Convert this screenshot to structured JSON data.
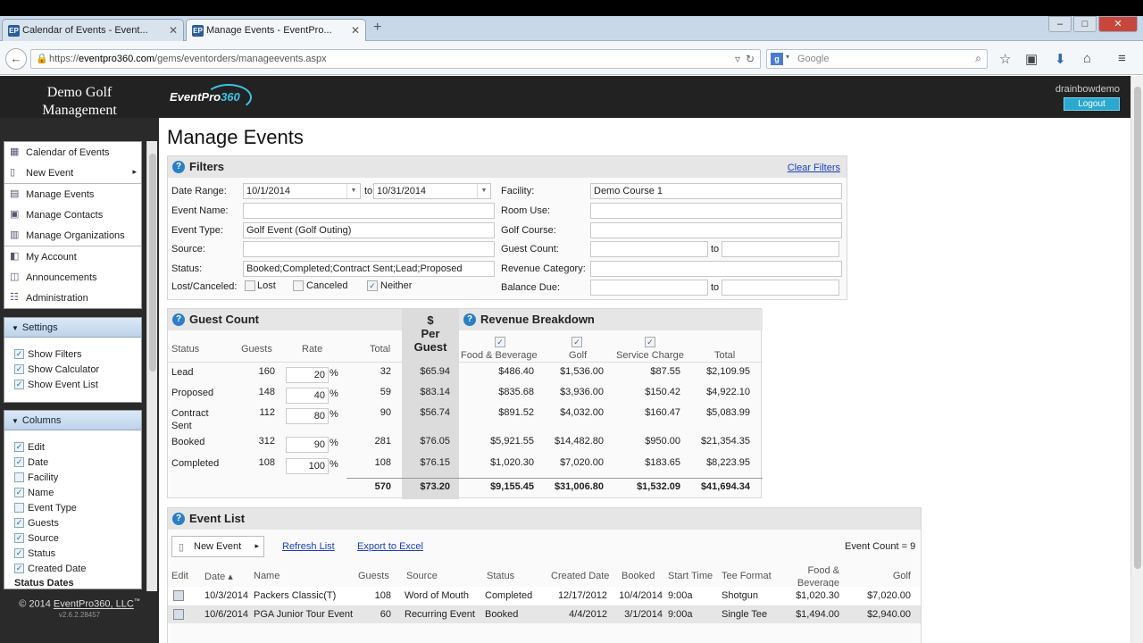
{
  "browser": {
    "tabs": [
      {
        "label": "Calendar of Events - Event...",
        "favicon": "EP"
      },
      {
        "label": "Manage Events - EventPro...",
        "favicon": "EP"
      }
    ],
    "new_tab": "+",
    "url_prefix": "https://",
    "url_domain": "eventpro360.com",
    "url_path": "/gems/eventorders/manageevents.aspx",
    "search_placeholder": "Google",
    "search_engine_letter": "g"
  },
  "header": {
    "brand_line1": "Demo Golf",
    "brand_line2": "Management",
    "logo_text": "EventPro",
    "logo_num": "360",
    "username": "drainbowdemo",
    "logout": "Logout"
  },
  "menu": {
    "items": [
      {
        "label": "Calendar of Events",
        "icon": "calendar-icon"
      },
      {
        "label": "New Event",
        "icon": "document-icon",
        "arrow": "▸"
      },
      {
        "label": "Manage Events",
        "icon": "list-icon"
      },
      {
        "label": "Manage Contacts",
        "icon": "contacts-icon"
      },
      {
        "label": "Manage Organizations",
        "icon": "building-icon"
      },
      {
        "label": "My Account",
        "icon": "account-icon"
      },
      {
        "label": "Announcements",
        "icon": "megaphone-icon"
      },
      {
        "label": "Administration",
        "icon": "admin-icon"
      }
    ]
  },
  "settings": {
    "title": "Settings",
    "items": [
      "Show Filters",
      "Show Calculator",
      "Show Event List"
    ]
  },
  "columns": {
    "title": "Columns",
    "items": [
      {
        "label": "Edit",
        "checked": true
      },
      {
        "label": "Date",
        "checked": true
      },
      {
        "label": "Facility",
        "checked": false
      },
      {
        "label": "Name",
        "checked": true
      },
      {
        "label": "Event Type",
        "checked": false
      },
      {
        "label": "Guests",
        "checked": true
      },
      {
        "label": "Source",
        "checked": true
      },
      {
        "label": "Status",
        "checked": true
      },
      {
        "label": "Created Date",
        "checked": true
      }
    ],
    "subheader": "Status Dates"
  },
  "footer": {
    "copyright": "© 2014",
    "company": "EventPro360, LLC",
    "tm": "™",
    "version": "v2.6.2.28457"
  },
  "page": {
    "title": "Manage Events"
  },
  "filters": {
    "title": "Filters",
    "clear": "Clear Filters",
    "date_range_label": "Date Range:",
    "date_from": "10/1/2014",
    "date_to_label": "to",
    "date_to": "10/31/2014",
    "event_name_label": "Event Name:",
    "event_name": "",
    "event_type_label": "Event Type:",
    "event_type": "Golf Event (Golf Outing)",
    "source_label": "Source:",
    "source": "",
    "status_label": "Status:",
    "status": "Booked;Completed;Contract Sent;Lead;Proposed",
    "lost_label": "Lost/Canceled:",
    "opt_lost": "Lost",
    "opt_canceled": "Canceled",
    "opt_neither": "Neither",
    "facility_label": "Facility:",
    "facility": "Demo Course 1",
    "room_use_label": "Room Use:",
    "golf_course_label": "Golf Course:",
    "guest_count_label": "Guest Count:",
    "guest_to": "to",
    "revenue_category_label": "Revenue Category:",
    "balance_due_label": "Balance Due:",
    "balance_to": "to"
  },
  "guest_count": {
    "title": "Guest Count",
    "cols": {
      "status": "Status",
      "guests": "Guests",
      "rate": "Rate",
      "total": "Total"
    },
    "per_guest_header": [
      "$",
      "Per",
      "Guest"
    ],
    "rows": [
      {
        "status": "Lead",
        "guests": "160",
        "rate": "20",
        "total": "32",
        "per_guest": "$65.94"
      },
      {
        "status": "Proposed",
        "guests": "148",
        "rate": "40",
        "total": "59",
        "per_guest": "$83.14"
      },
      {
        "status": "Contract Sent",
        "guests": "112",
        "rate": "80",
        "total": "90",
        "per_guest": "$56.74"
      },
      {
        "status": "Booked",
        "guests": "312",
        "rate": "90",
        "total": "281",
        "per_guest": "$76.05"
      },
      {
        "status": "Completed",
        "guests": "108",
        "rate": "100",
        "total": "108",
        "per_guest": "$76.15"
      }
    ],
    "pct": "%",
    "grand_total": "570",
    "per_guest_total": "$73.20"
  },
  "revenue": {
    "title": "Revenue Breakdown",
    "cols": {
      "fb": "Food & Beverage",
      "golf": "Golf",
      "svc": "Service Charge",
      "total": "Total"
    },
    "rows": [
      {
        "fb": "$486.40",
        "golf": "$1,536.00",
        "svc": "$87.55",
        "total": "$2,109.95"
      },
      {
        "fb": "$835.68",
        "golf": "$3,936.00",
        "svc": "$150.42",
        "total": "$4,922.10"
      },
      {
        "fb": "$891.52",
        "golf": "$4,032.00",
        "svc": "$160.47",
        "total": "$5,083.99"
      },
      {
        "fb": "$5,921.55",
        "golf": "$14,482.80",
        "svc": "$950.00",
        "total": "$21,354.35"
      },
      {
        "fb": "$1,020.30",
        "golf": "$7,020.00",
        "svc": "$183.65",
        "total": "$8,223.95"
      }
    ],
    "totals": {
      "fb": "$9,155.45",
      "golf": "$31,006.80",
      "svc": "$1,532.09",
      "total": "$41,694.34"
    }
  },
  "event_list": {
    "title": "Event List",
    "new_event": "New Event",
    "refresh": "Refresh List",
    "export": "Export to Excel",
    "count": "Event Count = 9",
    "cols": {
      "edit": "Edit",
      "date": "Date ▴",
      "name": "Name",
      "guests": "Guests",
      "source": "Source",
      "status": "Status",
      "created": "Created Date",
      "booked": "Booked",
      "start": "Start Time",
      "tee": "Tee Format",
      "fb1": "Food &",
      "fb2": "Beverage",
      "golf": "Golf"
    },
    "rows": [
      {
        "date": "10/3/2014",
        "name": "Packers Classic(T)",
        "guests": "108",
        "source": "Word of Mouth",
        "status": "Completed",
        "created": "12/17/2012",
        "booked": "10/4/2014",
        "start": "9:00a",
        "tee": "Shotgun",
        "fb": "$1,020.30",
        "golf": "$7,020.00"
      },
      {
        "date": "10/6/2014",
        "name": "PGA Junior Tour Event",
        "guests": "60",
        "source": "Recurring Event",
        "status": "Booked",
        "created": "4/4/2012",
        "booked": "3/1/2014",
        "start": "9:00a",
        "tee": "Single Tee",
        "fb": "$1,494.00",
        "golf": "$2,940.00"
      }
    ]
  }
}
